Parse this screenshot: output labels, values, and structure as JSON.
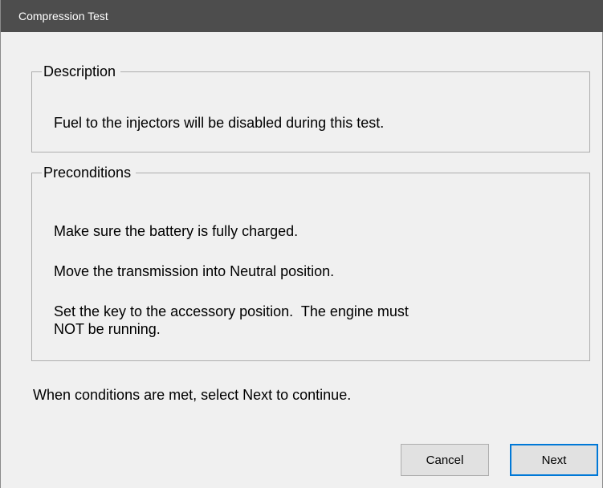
{
  "window": {
    "title": "Compression Test"
  },
  "description": {
    "legend": "Description",
    "text": "Fuel to the injectors will be disabled during this test."
  },
  "preconditions": {
    "legend": "Preconditions",
    "items": [
      "Make sure the battery is fully charged.",
      "Move the transmission into Neutral position.",
      "Set the key to the accessory position.  The engine must",
      "NOT be running."
    ]
  },
  "footer": {
    "instruction": "When conditions are met, select Next to continue."
  },
  "buttons": {
    "cancel_label": "Cancel",
    "next_label": "Next"
  },
  "colors": {
    "titlebar": "#4d4d4d",
    "window_bg": "#f0f0f0",
    "default_button_border": "#0078d7"
  }
}
